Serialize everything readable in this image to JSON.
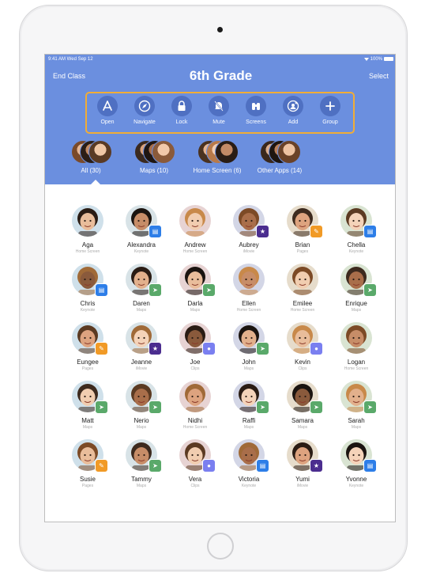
{
  "status": {
    "time_date": "9:41 AM  Wed Sep 12",
    "battery": "100%"
  },
  "nav": {
    "left": "End Class",
    "title": "6th Grade",
    "right": "Select"
  },
  "actions": [
    {
      "label": "Open",
      "icon": "app-store-icon"
    },
    {
      "label": "Navigate",
      "icon": "compass-icon"
    },
    {
      "label": "Lock",
      "icon": "lock-icon"
    },
    {
      "label": "Mute",
      "icon": "bell-slash-icon"
    },
    {
      "label": "Screens",
      "icon": "binoculars-icon"
    },
    {
      "label": "Add",
      "icon": "add-person-icon"
    },
    {
      "label": "Group",
      "icon": "plus-icon"
    }
  ],
  "groups": [
    {
      "label": "All (30)"
    },
    {
      "label": "Maps (10)"
    },
    {
      "label": "Home Screen (6)"
    },
    {
      "label": "Other Apps (14)"
    }
  ],
  "colors": {
    "accent": "#6b8fdf",
    "highlight": "#f1ad36",
    "action_circle": "#4f70c2"
  },
  "students": [
    {
      "name": "Aga",
      "app": "Home Screen"
    },
    {
      "name": "Alexandra",
      "app": "Keynote"
    },
    {
      "name": "Andrew",
      "app": "Home Screen"
    },
    {
      "name": "Aubrey",
      "app": "iMovie"
    },
    {
      "name": "Brian",
      "app": "Pages"
    },
    {
      "name": "Chella",
      "app": "Keynote"
    },
    {
      "name": "Chris",
      "app": "Keynote"
    },
    {
      "name": "Daren",
      "app": "Maps"
    },
    {
      "name": "Darla",
      "app": "Maps"
    },
    {
      "name": "Ellen",
      "app": "Home Screen"
    },
    {
      "name": "Emilee",
      "app": "Home Screen"
    },
    {
      "name": "Enrique",
      "app": "Maps"
    },
    {
      "name": "Eungee",
      "app": "Pages"
    },
    {
      "name": "Jeanne",
      "app": "iMovie"
    },
    {
      "name": "Joe",
      "app": "Clips"
    },
    {
      "name": "John",
      "app": "Maps"
    },
    {
      "name": "Kevin",
      "app": "Clips"
    },
    {
      "name": "Logan",
      "app": "Home Screen"
    },
    {
      "name": "Matt",
      "app": "Maps"
    },
    {
      "name": "Nerio",
      "app": "Maps"
    },
    {
      "name": "Nidhi",
      "app": "Home Screen"
    },
    {
      "name": "Raffi",
      "app": "Maps"
    },
    {
      "name": "Samara",
      "app": "Maps"
    },
    {
      "name": "Sarah",
      "app": "Maps"
    },
    {
      "name": "Susie",
      "app": "Pages"
    },
    {
      "name": "Tammy",
      "app": "Maps"
    },
    {
      "name": "Vera",
      "app": "Clips"
    },
    {
      "name": "Victoria",
      "app": "Keynote"
    },
    {
      "name": "Yumi",
      "app": "iMovie"
    },
    {
      "name": "Yvonne",
      "app": "Keynote"
    }
  ]
}
